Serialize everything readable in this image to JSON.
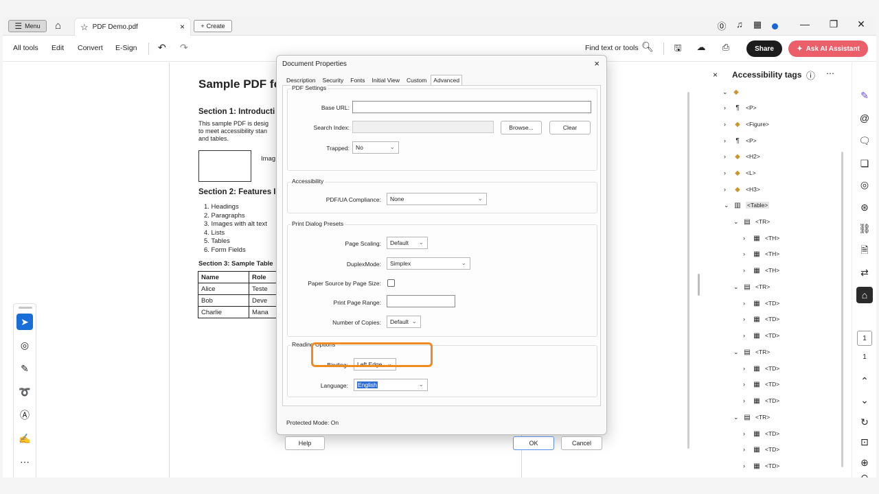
{
  "titlebar": {
    "menu_label": "Menu",
    "tab_title": "PDF Demo.pdf",
    "create_label": "Create"
  },
  "toolbar": {
    "all_tools": "All tools",
    "edit": "Edit",
    "convert": "Convert",
    "esign": "E-Sign",
    "find_placeholder": "Find text or tools",
    "share": "Share",
    "ai_assistant": "Ask AI Assistant"
  },
  "document": {
    "title": "Sample PDF fo",
    "section1_heading": "Section 1: Introducti",
    "section1_lines": [
      "This sample PDF is desig",
      "to meet accessibility stan",
      "and tables."
    ],
    "image_label": "Imag",
    "section2_heading": "Section 2: Features I",
    "list_items": [
      "1. Headings",
      "2. Paragraphs",
      "3. Images with alt text",
      "4. Lists",
      "5. Tables",
      "6. Form Fields"
    ],
    "section3_heading": "Section 3: Sample Table",
    "table": {
      "header": [
        "Name",
        "Role"
      ],
      "rows": [
        [
          "Alice",
          "Teste"
        ],
        [
          "Bob",
          "Deve"
        ],
        [
          "Charlie",
          "Mana"
        ]
      ]
    }
  },
  "dialog": {
    "title": "Document Properties",
    "tabs": [
      "Description",
      "Security",
      "Fonts",
      "Initial View",
      "Custom",
      "Advanced"
    ],
    "pdf_settings": {
      "title": "PDF Settings",
      "base_url_label": "Base URL:",
      "base_url_value": "",
      "search_index_label": "Search Index:",
      "browse": "Browse...",
      "clear": "Clear",
      "trapped_label": "Trapped:",
      "trapped_value": "No"
    },
    "accessibility": {
      "title": "Accessibility",
      "pdfua_label": "PDF/UA Compliance:",
      "pdfua_value": "None"
    },
    "print_presets": {
      "title": "Print Dialog Presets",
      "page_scaling_label": "Page Scaling:",
      "page_scaling_value": "Default",
      "duplex_label": "DuplexMode:",
      "duplex_value": "Simplex",
      "paper_source_label": "Paper Source by Page Size:",
      "print_range_label": "Print Page Range:",
      "print_range_value": "",
      "copies_label": "Number of Copies:",
      "copies_value": "Default"
    },
    "reading": {
      "title": "Reading Options",
      "binding_label": "Binding:",
      "binding_value": "Left Edge",
      "language_label": "Language:",
      "language_value": "English"
    },
    "protected_mode": "Protected Mode:  On",
    "help": "Help",
    "ok": "OK",
    "cancel": "Cancel"
  },
  "panel": {
    "title": "Accessibility tags",
    "tree": [
      {
        "label": "",
        "icon": "tag"
      },
      {
        "label": "<P>",
        "icon": "paragraph"
      },
      {
        "label": "<Figure>",
        "icon": "tag"
      },
      {
        "label": "<P>",
        "icon": "paragraph"
      },
      {
        "label": "<H2>",
        "icon": "tag"
      },
      {
        "label": "<L>",
        "icon": "tag"
      },
      {
        "label": "<H3>",
        "icon": "tag"
      },
      {
        "label": "<Table>",
        "icon": "table"
      },
      {
        "label": "<TR>",
        "icon": "row"
      },
      {
        "label": "<TH>",
        "icon": "cell"
      },
      {
        "label": "<TH>",
        "icon": "cell"
      },
      {
        "label": "<TH>",
        "icon": "cell"
      },
      {
        "label": "<TR>",
        "icon": "row"
      },
      {
        "label": "<TD>",
        "icon": "cell"
      },
      {
        "label": "<TD>",
        "icon": "cell"
      },
      {
        "label": "<TD>",
        "icon": "cell"
      },
      {
        "label": "<TR>",
        "icon": "row"
      },
      {
        "label": "<TD>",
        "icon": "cell"
      },
      {
        "label": "<TD>",
        "icon": "cell"
      },
      {
        "label": "<TD>",
        "icon": "cell"
      },
      {
        "label": "<TR>",
        "icon": "row"
      },
      {
        "label": "<TD>",
        "icon": "cell"
      },
      {
        "label": "<TD>",
        "icon": "cell"
      },
      {
        "label": "<TD>",
        "icon": "cell"
      }
    ]
  },
  "rail": {
    "current_page": "1",
    "total_pages": "1"
  }
}
